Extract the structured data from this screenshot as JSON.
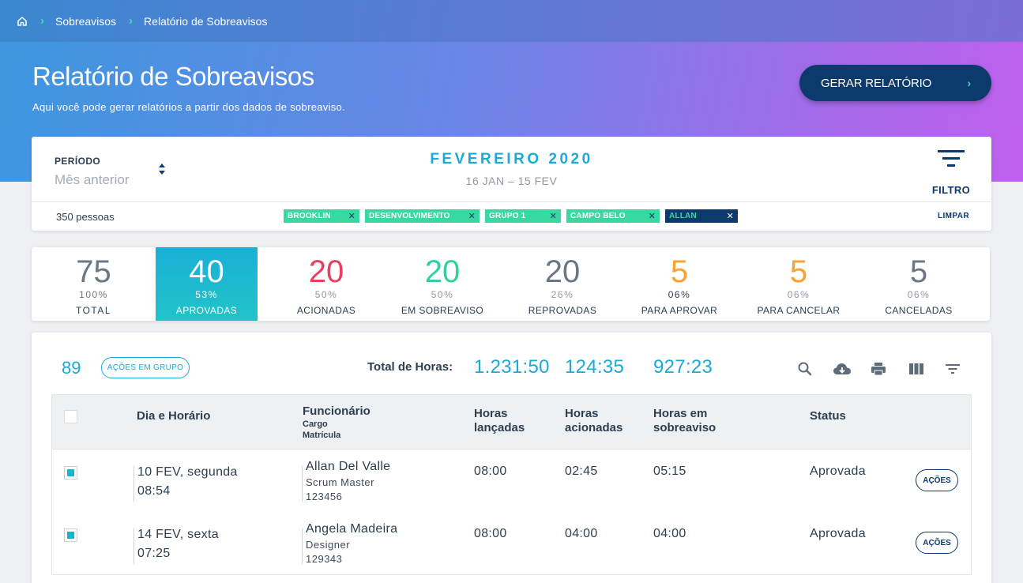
{
  "breadcrumb": {
    "items": [
      "Sobreavisos",
      "Relatório de Sobreavisos"
    ]
  },
  "header": {
    "title": "Relatório de Sobreavisos",
    "subtitle": "Aqui você pode gerar relatórios a partir dos dados de sobreaviso.",
    "action_label": "GERAR RELATÓRIO"
  },
  "filter": {
    "period_label": "PERÍODO",
    "period_value": "Mês anterior",
    "month": "FEVEREIRO 2020",
    "range": "16 JAN – 15 FEV",
    "filter_label": "FILTRO",
    "people_count": "350 pessoas",
    "chips": [
      "BROOKLIN",
      "DESENVOLVIMENTO",
      "GRUPO 1",
      "CAMPO BELO",
      "ALLAN"
    ],
    "clear_label": "LIMPAR"
  },
  "stats": [
    {
      "value": "75",
      "pct": "100%",
      "label": "TOTAL",
      "color": "#6b7785"
    },
    {
      "value": "40",
      "pct": "53%",
      "label": "APROVADAS",
      "color": "#ffffff"
    },
    {
      "value": "20",
      "pct": "50%",
      "label": "ACIONADAS",
      "color": "#ea3d5f"
    },
    {
      "value": "20",
      "pct": "50%",
      "label": "EM SOBREAVISO",
      "color": "#2fd1a0"
    },
    {
      "value": "20",
      "pct": "26%",
      "label": "REPROVADAS",
      "color": "#6b7785"
    },
    {
      "value": "5",
      "pct": "06%",
      "label": "PARA APROVAR",
      "color": "#f7a331"
    },
    {
      "value": "5",
      "pct": "06%",
      "label": "PARA CANCELAR",
      "color": "#f7a331"
    },
    {
      "value": "5",
      "pct": "06%",
      "label": "CANCELADAS",
      "color": "#6b7785"
    }
  ],
  "table": {
    "count": "89",
    "group_actions_label": "AÇÕES EM GRUPO",
    "total_hours_label": "Total de Horas:",
    "totals": [
      "1.231:50",
      "124:35",
      "927:23"
    ],
    "toolbar_icons": [
      "search-icon",
      "cloud-download-icon",
      "print-icon",
      "columns-icon",
      "filter-list-icon"
    ],
    "headers": {
      "date": "Dia e Horário",
      "employee": "Funcionário",
      "employee_sub1": "Cargo",
      "employee_sub2": "Matrícula",
      "launched_1": "Horas",
      "launched_2": "lançadas",
      "triggered_1": "Horas",
      "triggered_2": "acionadas",
      "standby_1": "Horas em",
      "standby_2": "sobreaviso",
      "status": "Status"
    },
    "rows": [
      {
        "date": "10 FEV, segunda",
        "time": "08:54",
        "name": "Allan Del Valle",
        "role": "Scrum Master",
        "id": "123456",
        "launched": "08:00",
        "triggered": "02:45",
        "standby": "05:15",
        "status": "Aprovada",
        "action": "AÇÕES"
      },
      {
        "date": "14 FEV, sexta",
        "time": "07:25",
        "name": "Angela Madeira",
        "role": "Designer",
        "id": "129343",
        "launched": "08:00",
        "triggered": "04:00",
        "standby": "04:00",
        "status": "Aprovada",
        "action": "AÇÕES"
      }
    ]
  }
}
